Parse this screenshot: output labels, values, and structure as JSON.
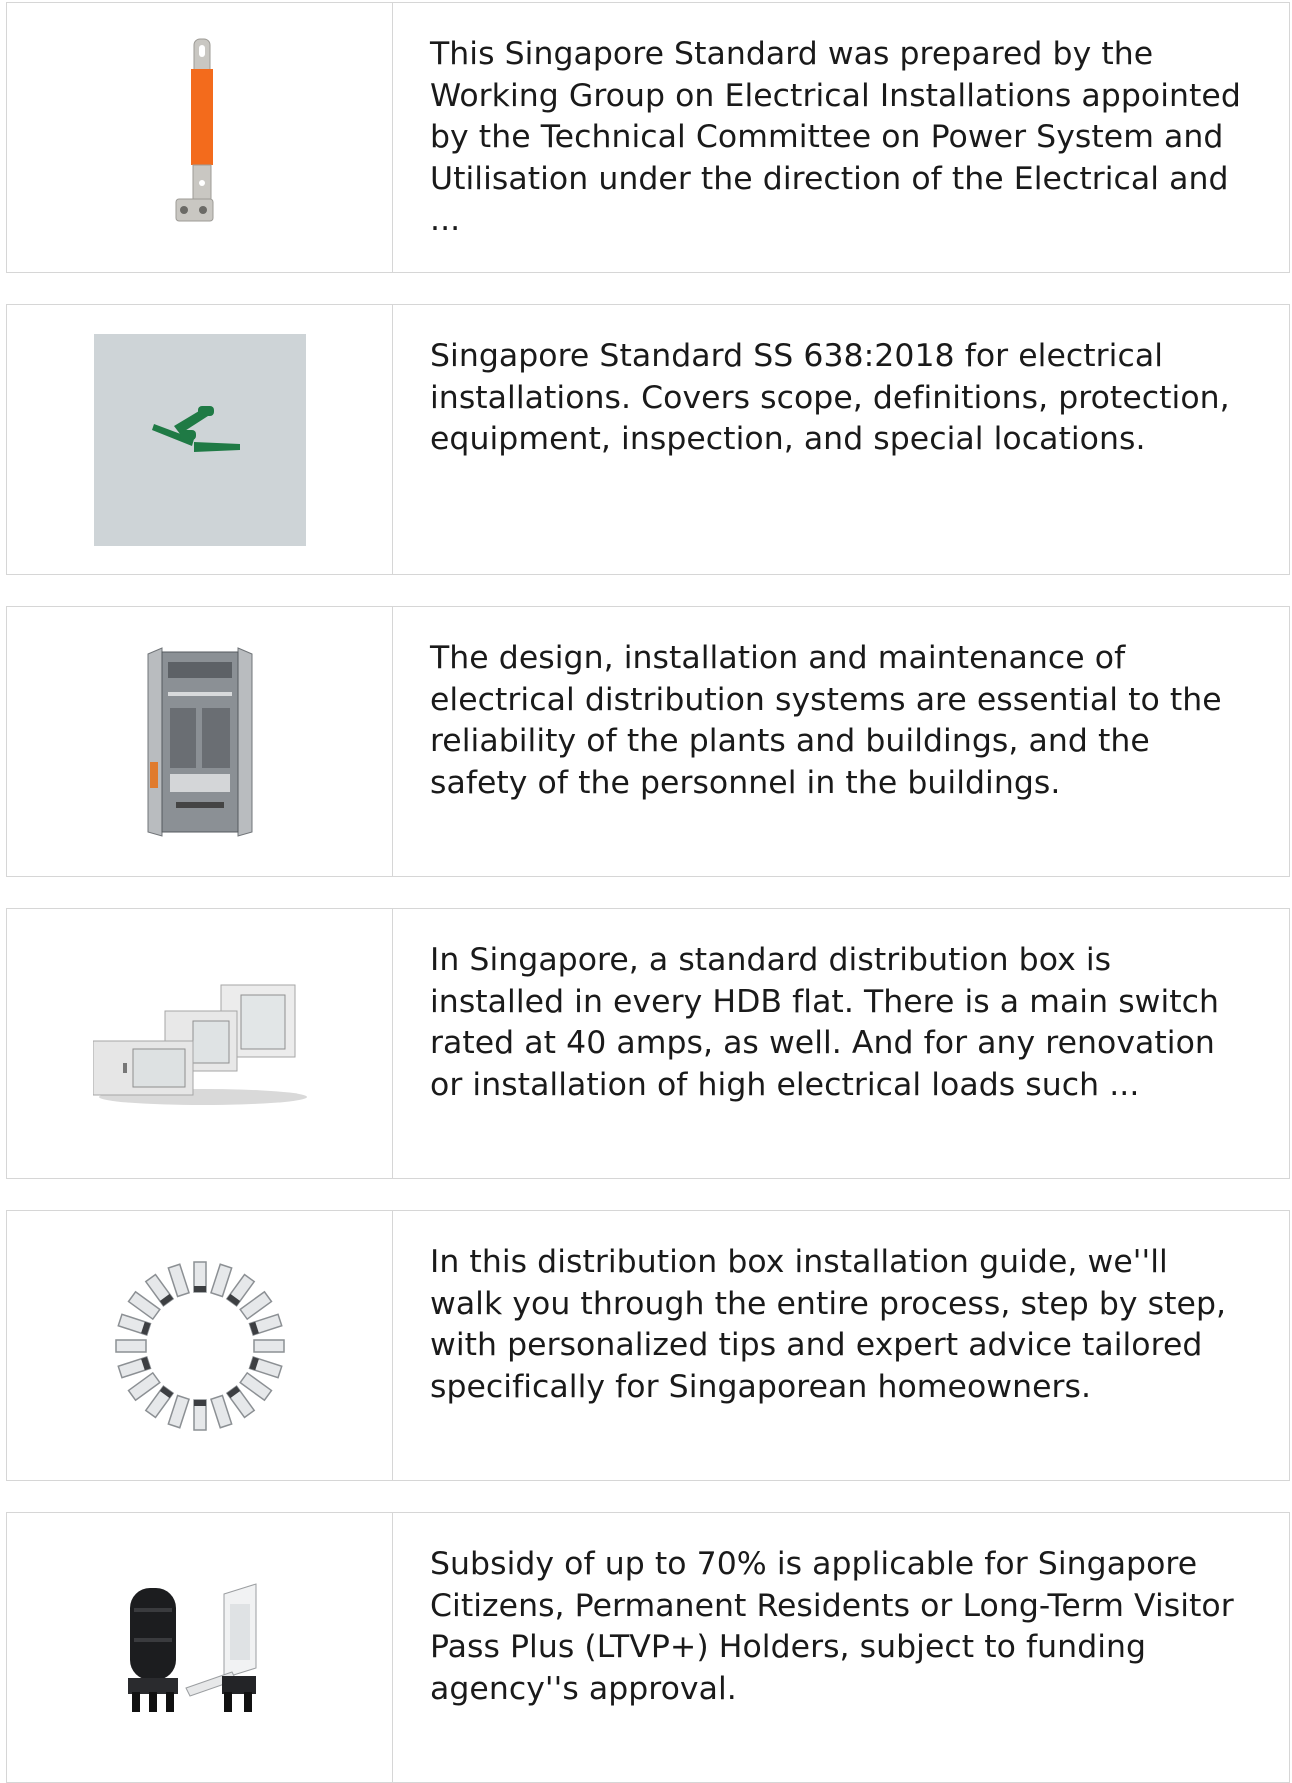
{
  "items": [
    {
      "image": "copper-busbar-connector-image",
      "description": "This Singapore Standard was prepared by the Working Group on Electrical Installations appointed by the Technical Committee on Power System and Utilisation under the direction of the Electrical and ..."
    },
    {
      "image": "green-wire-connectors-image",
      "description": "Singapore Standard SS 638:2018 for electrical installations. Covers scope, definitions, protection, equipment, inspection, and special locations."
    },
    {
      "image": "electrical-cabinet-open-doors-image",
      "description": "The design, installation and maintenance of electrical distribution systems are essential to the reliability of the plants and buildings, and the safety of the personnel in the buildings."
    },
    {
      "image": "wall-mount-network-cabinets-image",
      "description": "In Singapore, a standard distribution box is installed in every HDB flat. There is a main switch rated at 40 amps, as well. And for any renovation or installation of high electrical loads such ..."
    },
    {
      "image": "sfp-transceiver-modules-circle-image",
      "description": "In this distribution box installation guide, we''ll walk you through the entire process, step by step, with personalized tips and expert advice tailored specifically for Singaporean homeowners."
    },
    {
      "image": "fiber-splice-closure-image",
      "description": "Subsidy of up to 70% is applicable for Singapore Citizens, Permanent Residents or Long-Term Visitor Pass Plus (LTVP+) Holders, subject to funding agency''s approval."
    }
  ]
}
